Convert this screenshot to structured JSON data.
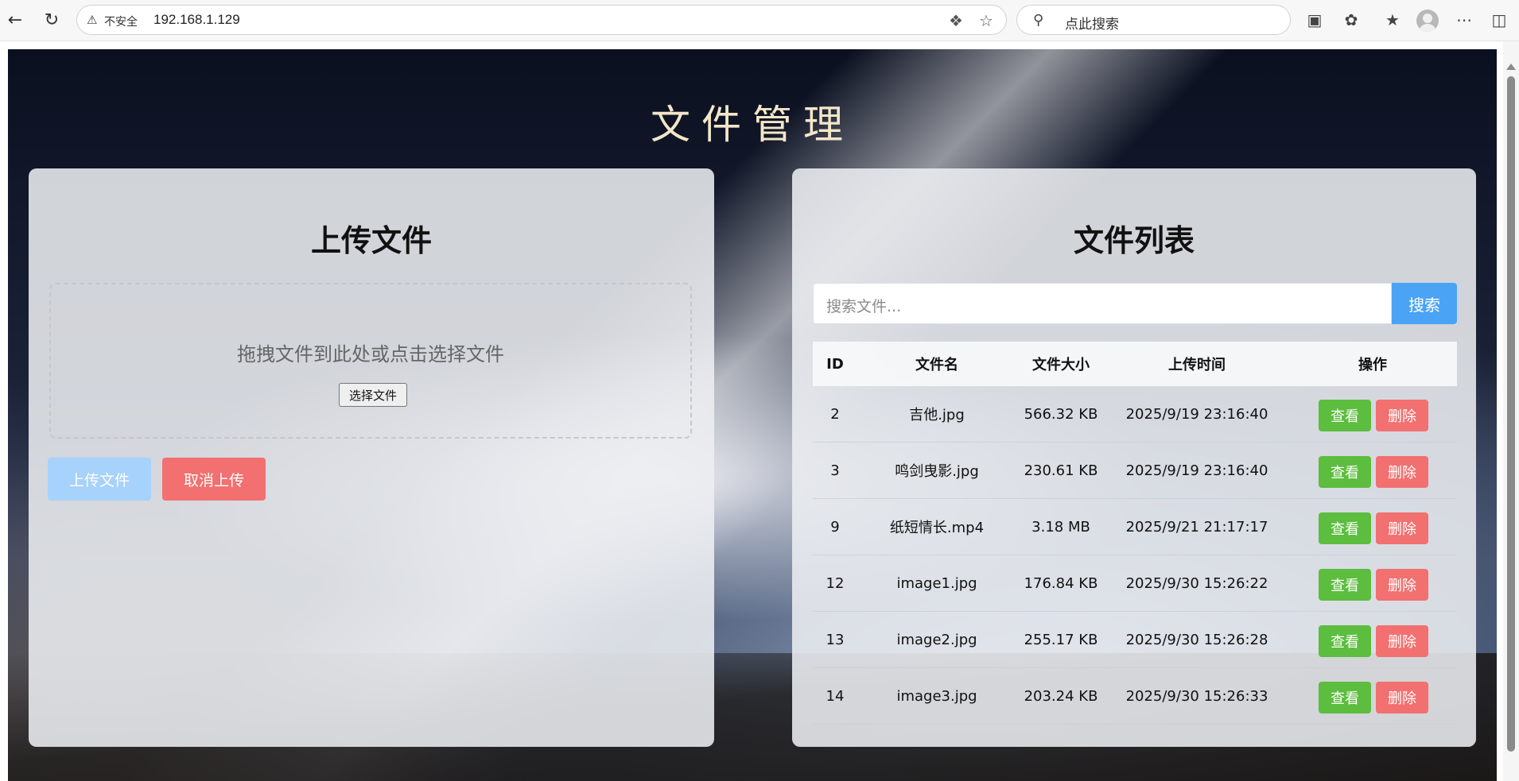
{
  "browser": {
    "security_label": "不安全",
    "url": "192.168.1.129",
    "search_placeholder": "点此搜索"
  },
  "page": {
    "title": "文件管理"
  },
  "upload": {
    "heading": "上传文件",
    "drop_text": "拖拽文件到此处或点击选择文件",
    "choose_label": "选择文件",
    "upload_label": "上传文件",
    "cancel_label": "取消上传"
  },
  "files": {
    "heading": "文件列表",
    "search_placeholder": "搜索文件...",
    "search_label": "搜索",
    "columns": [
      "ID",
      "文件名",
      "文件大小",
      "上传时间",
      "操作"
    ],
    "view_label": "查看",
    "delete_label": "删除",
    "rows": [
      {
        "id": "2",
        "name": "吉他.jpg",
        "size": "566.32 KB",
        "time": "2025/9/19 23:16:40"
      },
      {
        "id": "3",
        "name": "鸣剑曳影.jpg",
        "size": "230.61 KB",
        "time": "2025/9/19 23:16:40"
      },
      {
        "id": "9",
        "name": "纸短情长.mp4",
        "size": "3.18 MB",
        "time": "2025/9/21 21:17:17"
      },
      {
        "id": "12",
        "name": "image1.jpg",
        "size": "176.84 KB",
        "time": "2025/9/30 15:26:22"
      },
      {
        "id": "13",
        "name": "image2.jpg",
        "size": "255.17 KB",
        "time": "2025/9/30 15:26:28"
      },
      {
        "id": "14",
        "name": "image3.jpg",
        "size": "203.24 KB",
        "time": "2025/9/30 15:26:33"
      }
    ]
  },
  "colors": {
    "primary_light": "#a7d2fb",
    "primary": "#4aa3f5",
    "success": "#5cbd3e",
    "danger": "#f27070"
  }
}
